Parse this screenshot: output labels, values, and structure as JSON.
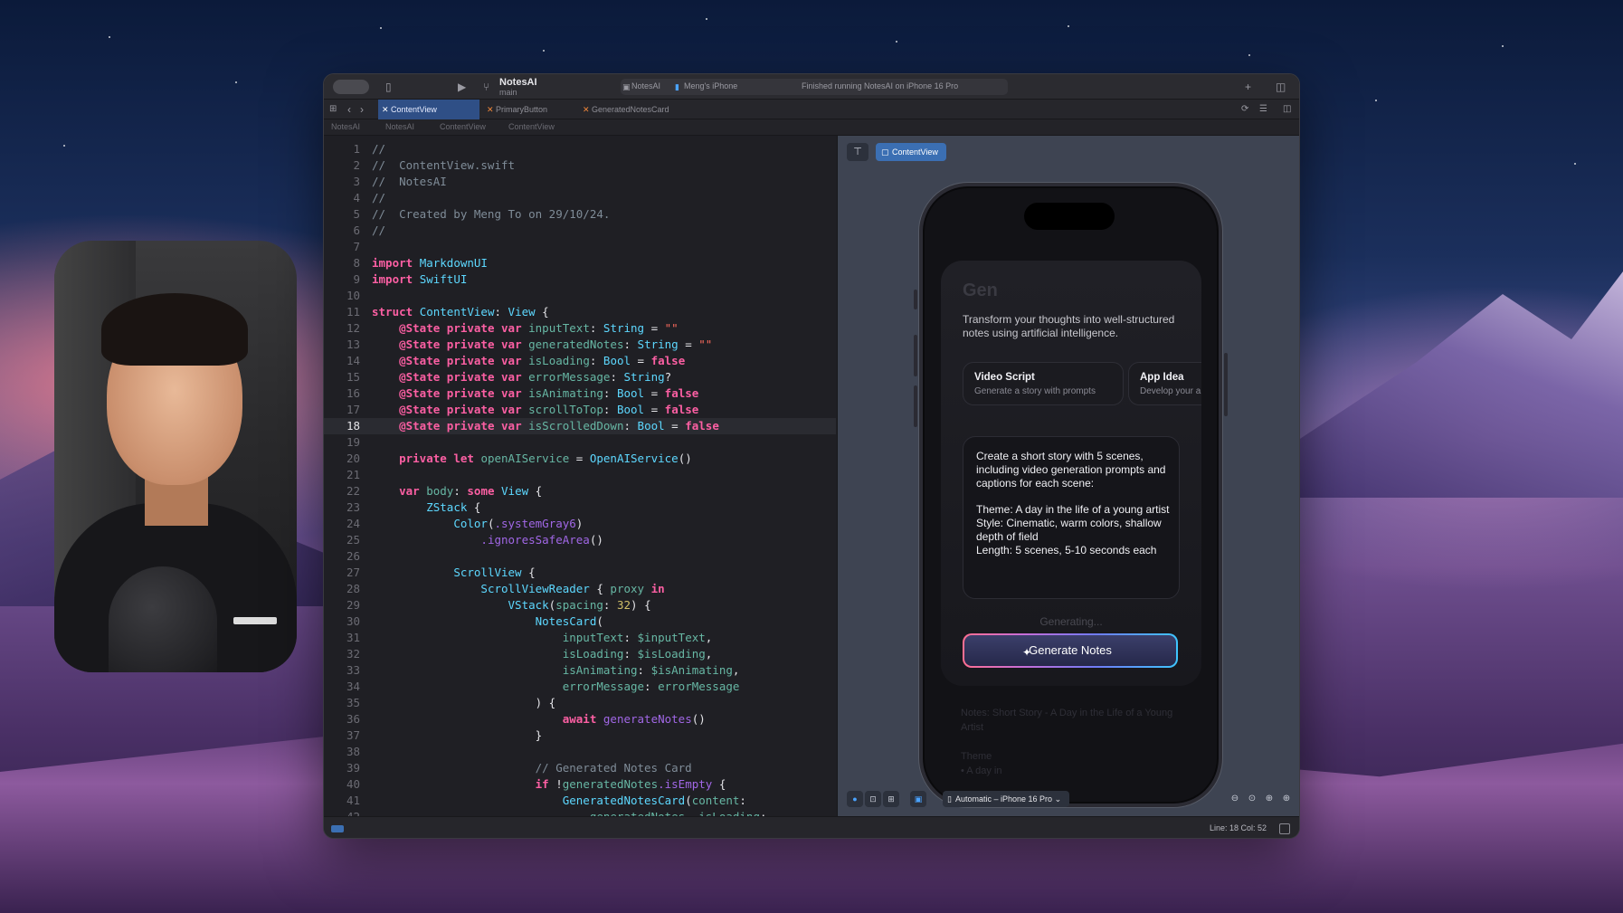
{
  "window": {
    "project_name": "NotesAI",
    "branch": "main",
    "scheme_app": "NotesAI",
    "scheme_device": "Meng's iPhone",
    "run_status": "Finished running NotesAI on iPhone 16 Pro"
  },
  "tabs": [
    {
      "label": "ContentView",
      "active": true
    },
    {
      "label": "PrimaryButton",
      "active": false
    },
    {
      "label": "GeneratedNotesCard",
      "active": false
    }
  ],
  "breadcrumbs": [
    "NotesAI",
    "NotesAI",
    "ContentView",
    "ContentView"
  ],
  "editor": {
    "current_line": 18,
    "lines": [
      "//",
      "//  ContentView.swift",
      "//  NotesAI",
      "//",
      "//  Created by Meng To on 29/10/24.",
      "//",
      "",
      "import MarkdownUI",
      "import SwiftUI",
      "",
      "struct ContentView: View {",
      "    @State private var inputText: String = \"\"",
      "    @State private var generatedNotes: String = \"\"",
      "    @State private var isLoading: Bool = false",
      "    @State private var errorMessage: String?",
      "    @State private var isAnimating: Bool = false",
      "    @State private var scrollToTop: Bool = false",
      "    @State private var isScrolledDown: Bool = false",
      "",
      "    private let openAIService = OpenAIService()",
      "",
      "    var body: some View {",
      "        ZStack {",
      "            Color(.systemGray6)",
      "                .ignoresSafeArea()",
      "",
      "            ScrollView {",
      "                ScrollViewReader { proxy in",
      "                    VStack(spacing: 32) {",
      "                        NotesCard(",
      "                            inputText: $inputText,",
      "                            isLoading: $isLoading,",
      "                            isAnimating: $isAnimating,",
      "                            errorMessage: errorMessage",
      "                        ) {",
      "                            await generateNotes()",
      "                        }",
      "",
      "                        // Generated Notes Card",
      "                        if !generatedNotes.isEmpty {",
      "                            GeneratedNotesCard(content:",
      "                                generatedNotes, isLoading:"
    ]
  },
  "preview": {
    "pin_label": "📌",
    "content_view_label": "ContentView",
    "device_label": "Automatic – iPhone 16 Pro",
    "app": {
      "title": "Gen",
      "subtitle": "Transform your thoughts into well-structured notes using artificial intelligence.",
      "chips": [
        {
          "title": "Video Script",
          "subtitle": "Generate a story with prompts"
        },
        {
          "title": "App Idea",
          "subtitle": "Develop your a"
        }
      ],
      "prompt": "Create a short story with 5 scenes, including video generation prompts and captions for each scene:\n\nTheme: A day in the life of a young artist\nStyle: Cinematic, warm colors, shallow depth of field\nLength: 5 scenes, 5-10 seconds each",
      "generating_label": "Generating...",
      "generate_button": "Generate Notes",
      "faded_text": "Notes: Short Story - A Day in the Life of a Young Artist\n\nTheme\n• A day in"
    }
  },
  "status": {
    "position": "Line: 18  Col: 52"
  },
  "colors": {
    "keyword": "#fc5fa3",
    "type": "#5dd8ff",
    "string": "#fc6a5d",
    "comment": "#7f8c98",
    "accent": "#3b6fb3"
  }
}
